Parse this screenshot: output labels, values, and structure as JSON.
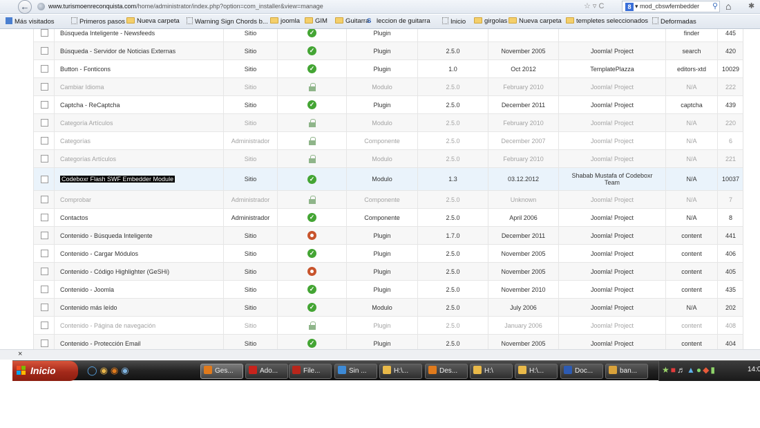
{
  "browser": {
    "url_host": "www.turismoenreconquista.com",
    "url_path": "/home/administrator/index.php?option=com_installer&view=manage",
    "search_text": "mod_cbswfembedder",
    "toolbar_right_glyphs": "☆ ▿ C"
  },
  "bookmarks": [
    {
      "label": "Más visitados",
      "icon": "star-page-icon"
    },
    {
      "label": "Primeros pasos",
      "icon": "page-icon"
    },
    {
      "label": "Nueva carpeta",
      "icon": "folder-icon"
    },
    {
      "label": "Warning Sign Chords b...",
      "icon": "page-icon"
    },
    {
      "label": "joomla",
      "icon": "folder-icon"
    },
    {
      "label": "GIM",
      "icon": "folder-icon"
    },
    {
      "label": "Guitarra",
      "icon": "folder-icon"
    },
    {
      "label": "leccion de guitarra",
      "icon": "s-site-icon"
    },
    {
      "label": "Inicio",
      "icon": "page-icon"
    },
    {
      "label": "girgolas",
      "icon": "folder-icon"
    },
    {
      "label": "Nueva carpeta",
      "icon": "folder-icon"
    },
    {
      "label": "templetes seleccionados",
      "icon": "folder-icon"
    },
    {
      "label": "Deformadas",
      "icon": "page-icon"
    }
  ],
  "extensions": [
    {
      "name": "Búsqueda Inteligente - Newsfeeds",
      "location": "Sitio",
      "status": "enabled",
      "type": "Plugin",
      "version": "",
      "date": "",
      "author": "",
      "folder": "finder",
      "id": "445",
      "disabled": false
    },
    {
      "name": "Búsqueda - Servidor de Noticias Externas",
      "location": "Sitio",
      "status": "enabled",
      "type": "Plugin",
      "version": "2.5.0",
      "date": "November 2005",
      "author": "Joomla! Project",
      "folder": "search",
      "id": "420",
      "disabled": false
    },
    {
      "name": "Button - Fonticons",
      "location": "Sitio",
      "status": "enabled",
      "type": "Plugin",
      "version": "1.0",
      "date": "Oct 2012",
      "author": "TemplatePlazza",
      "folder": "editors-xtd",
      "id": "10029",
      "disabled": false
    },
    {
      "name": "Cambiar Idioma",
      "location": "Sitio",
      "status": "locked",
      "type": "Modulo",
      "version": "2.5.0",
      "date": "February 2010",
      "author": "Joomla! Project",
      "folder": "N/A",
      "id": "222",
      "disabled": true
    },
    {
      "name": "Captcha - ReCaptcha",
      "location": "Sitio",
      "status": "enabled",
      "type": "Plugin",
      "version": "2.5.0",
      "date": "December 2011",
      "author": "Joomla! Project",
      "folder": "captcha",
      "id": "439",
      "disabled": false
    },
    {
      "name": "Categoría Artículos",
      "location": "Sitio",
      "status": "locked",
      "type": "Modulo",
      "version": "2.5.0",
      "date": "February 2010",
      "author": "Joomla! Project",
      "folder": "N/A",
      "id": "220",
      "disabled": true
    },
    {
      "name": "Categorías",
      "location": "Administrador",
      "status": "locked",
      "type": "Componente",
      "version": "2.5.0",
      "date": "December 2007",
      "author": "Joomla! Project",
      "folder": "N/A",
      "id": "6",
      "disabled": true
    },
    {
      "name": "Categorías Artículos",
      "location": "Sitio",
      "status": "locked",
      "type": "Modulo",
      "version": "2.5.0",
      "date": "February 2010",
      "author": "Joomla! Project",
      "folder": "N/A",
      "id": "221",
      "disabled": true
    },
    {
      "name": "Codeboxr Flash SWF Embedder Module",
      "location": "Sitio",
      "status": "enabled",
      "type": "Modulo",
      "version": "1.3",
      "date": "03.12.2012",
      "author": "Shabab Mustafa of Codeboxr Team",
      "folder": "N/A",
      "id": "10037",
      "disabled": false,
      "selected": true
    },
    {
      "name": "Comprobar",
      "location": "Administrador",
      "status": "locked",
      "type": "Componente",
      "version": "2.5.0",
      "date": "Unknown",
      "author": "Joomla! Project",
      "folder": "N/A",
      "id": "7",
      "disabled": true
    },
    {
      "name": "Contactos",
      "location": "Administrador",
      "status": "enabled",
      "type": "Componente",
      "version": "2.5.0",
      "date": "April 2006",
      "author": "Joomla! Project",
      "folder": "N/A",
      "id": "8",
      "disabled": false
    },
    {
      "name": "Contenido - Búsqueda Inteligente",
      "location": "Sitio",
      "status": "disabled",
      "type": "Plugin",
      "version": "1.7.0",
      "date": "December 2011",
      "author": "Joomla! Project",
      "folder": "content",
      "id": "441",
      "disabled": false
    },
    {
      "name": "Contenido - Cargar Módulos",
      "location": "Sitio",
      "status": "enabled",
      "type": "Plugin",
      "version": "2.5.0",
      "date": "November 2005",
      "author": "Joomla! Project",
      "folder": "content",
      "id": "406",
      "disabled": false
    },
    {
      "name": "Contenido - Código Highlighter (GeSHi)",
      "location": "Sitio",
      "status": "disabled",
      "type": "Plugin",
      "version": "2.5.0",
      "date": "November 2005",
      "author": "Joomla! Project",
      "folder": "content",
      "id": "405",
      "disabled": false
    },
    {
      "name": "Contenido - Joomla",
      "location": "Sitio",
      "status": "enabled",
      "type": "Plugin",
      "version": "2.5.0",
      "date": "November 2010",
      "author": "Joomla! Project",
      "folder": "content",
      "id": "435",
      "disabled": false
    },
    {
      "name": "Contenido más leído",
      "location": "Sitio",
      "status": "enabled",
      "type": "Modulo",
      "version": "2.5.0",
      "date": "July 2006",
      "author": "Joomla! Project",
      "folder": "N/A",
      "id": "202",
      "disabled": false
    },
    {
      "name": "Contenido - Página de navegación",
      "location": "Sitio",
      "status": "locked",
      "type": "Plugin",
      "version": "2.5.0",
      "date": "January 2006",
      "author": "Joomla! Project",
      "folder": "content",
      "id": "408",
      "disabled": true
    },
    {
      "name": "Contenido - Protección Email",
      "location": "Sitio",
      "status": "enabled",
      "type": "Plugin",
      "version": "2.5.0",
      "date": "November 2005",
      "author": "Joomla! Project",
      "folder": "content",
      "id": "404",
      "disabled": false
    }
  ],
  "close_glyph": "×",
  "taskbar": {
    "start_label": "Inicio",
    "tasks": [
      {
        "label": "Ges...",
        "icon": "firefox-icon",
        "color": "#e07a1c",
        "active": true
      },
      {
        "label": "Ado...",
        "icon": "adobe-icon",
        "color": "#c8231c",
        "active": false
      },
      {
        "label": "File...",
        "icon": "filezilla-icon",
        "color": "#b8261b",
        "active": false
      },
      {
        "label": "Sin ...",
        "icon": "notepad-icon",
        "color": "#3d8ad6",
        "active": false
      },
      {
        "label": "H:\\...",
        "icon": "folder-icon",
        "color": "#e9b949",
        "active": false
      },
      {
        "label": "Des...",
        "icon": "firefox-icon",
        "color": "#e07a1c",
        "active": false
      },
      {
        "label": "H:\\",
        "icon": "folder-icon",
        "color": "#e9b949",
        "active": false
      },
      {
        "label": "H:\\...",
        "icon": "folder-icon",
        "color": "#e9b949",
        "active": false
      },
      {
        "label": "Doc...",
        "icon": "word-icon",
        "color": "#2d5bb3",
        "active": false
      },
      {
        "label": "ban...",
        "icon": "paint-icon",
        "color": "#d9a23a",
        "active": false
      }
    ],
    "clock": "14:0"
  }
}
